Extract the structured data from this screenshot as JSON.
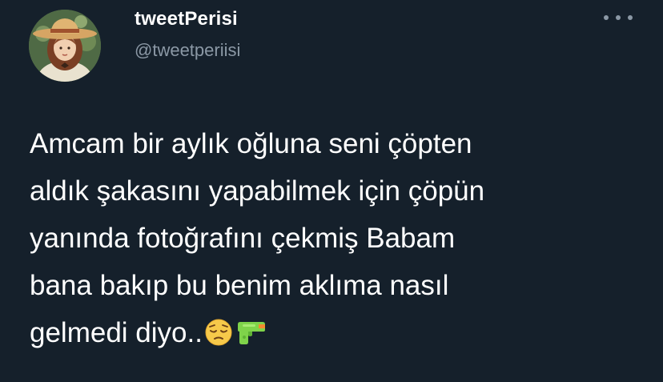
{
  "tweet": {
    "display_name": "tweetPerisi",
    "handle": "@tweetperiisi",
    "more_icon": "more-horizontal-icon",
    "text_lines": [
      "Amcam bir aylık oğluna seni çöpten",
      "aldık şakasını yapabilmek için çöpün",
      "yanında fotoğrafını çekmiş Babam",
      "bana bakıp bu benim aklıma nasıl",
      "gelmedi diyo.."
    ],
    "emojis": [
      "pensive-face-emoji",
      "water-pistol-emoji"
    ]
  },
  "colors": {
    "background": "#15202b",
    "text_primary": "#ffffff",
    "text_secondary": "#8b98a5"
  }
}
